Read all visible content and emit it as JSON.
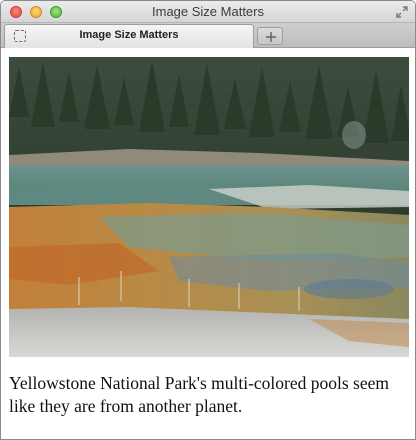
{
  "window": {
    "title": "Image Size Matters"
  },
  "tabs": [
    {
      "label": "Image Size Matters",
      "active": true
    }
  ],
  "new_tab_icon": "plus-icon",
  "page": {
    "caption": "Yellowstone National Park's multi-colored pools seem like they are from another planet."
  },
  "colors": {
    "titlebar": "#dcdcdc",
    "close": "#e0443e",
    "minimize": "#e2a62c",
    "zoom": "#4fb43b"
  }
}
